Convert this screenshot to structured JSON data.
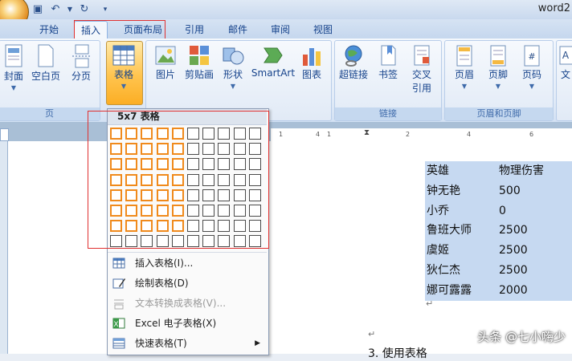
{
  "window": {
    "title": "word2"
  },
  "tabs": [
    "开始",
    "插入",
    "页面布局",
    "引用",
    "邮件",
    "审阅",
    "视图"
  ],
  "active_tab": "插入",
  "ribbon": {
    "page_group": {
      "label": "页",
      "cover": "封面",
      "blank_page": "空白页",
      "page_break": "分页"
    },
    "table_button": "表格",
    "illustrations": {
      "picture": "图片",
      "clipart": "剪贴画",
      "shapes": "形状",
      "smartart": "SmartArt",
      "chart": "图表"
    },
    "links_group": {
      "label": "链接",
      "hyperlink": "超链接",
      "bookmark": "书签",
      "cross_ref_line1": "交叉",
      "cross_ref_line2": "引用"
    },
    "header_footer_group": {
      "label": "页眉和页脚",
      "header": "页眉",
      "footer": "页脚",
      "page_number": "页码"
    },
    "text_partial": "文"
  },
  "table_menu": {
    "title": "5x7 表格",
    "grid_cols": 10,
    "grid_rows": 8,
    "selected_cols": 5,
    "selected_rows": 7,
    "items": [
      {
        "label": "插入表格(I)...",
        "icon": "insert-table-icon"
      },
      {
        "label": "绘制表格(D)",
        "icon": "draw-table-icon"
      },
      {
        "label": "文本转换成表格(V)...",
        "icon": "convert-text-icon"
      },
      {
        "label": "Excel 电子表格(X)",
        "icon": "excel-icon"
      },
      {
        "label": "快速表格(T)",
        "icon": "quick-table-icon"
      }
    ]
  },
  "ruler": {
    "labels": [
      "1",
      "4",
      "1",
      "2",
      "4",
      "6"
    ]
  },
  "document": {
    "table": [
      [
        "英雄",
        "物理伤害"
      ],
      [
        "钟无艳",
        "500"
      ],
      [
        "小乔",
        "0"
      ],
      [
        "鲁班大师",
        "2500"
      ],
      [
        "虞姬",
        "2500"
      ],
      [
        "狄仁杰",
        "2500"
      ],
      [
        "娜可露露",
        "2000"
      ]
    ],
    "bottom_text": "3.  使用表格"
  },
  "watermark": "头条 @七小嗨少",
  "colors": {
    "accent_orange": "#f08a1c",
    "selection_bg": "#c6d9f1",
    "highlight_red": "#e03030"
  }
}
